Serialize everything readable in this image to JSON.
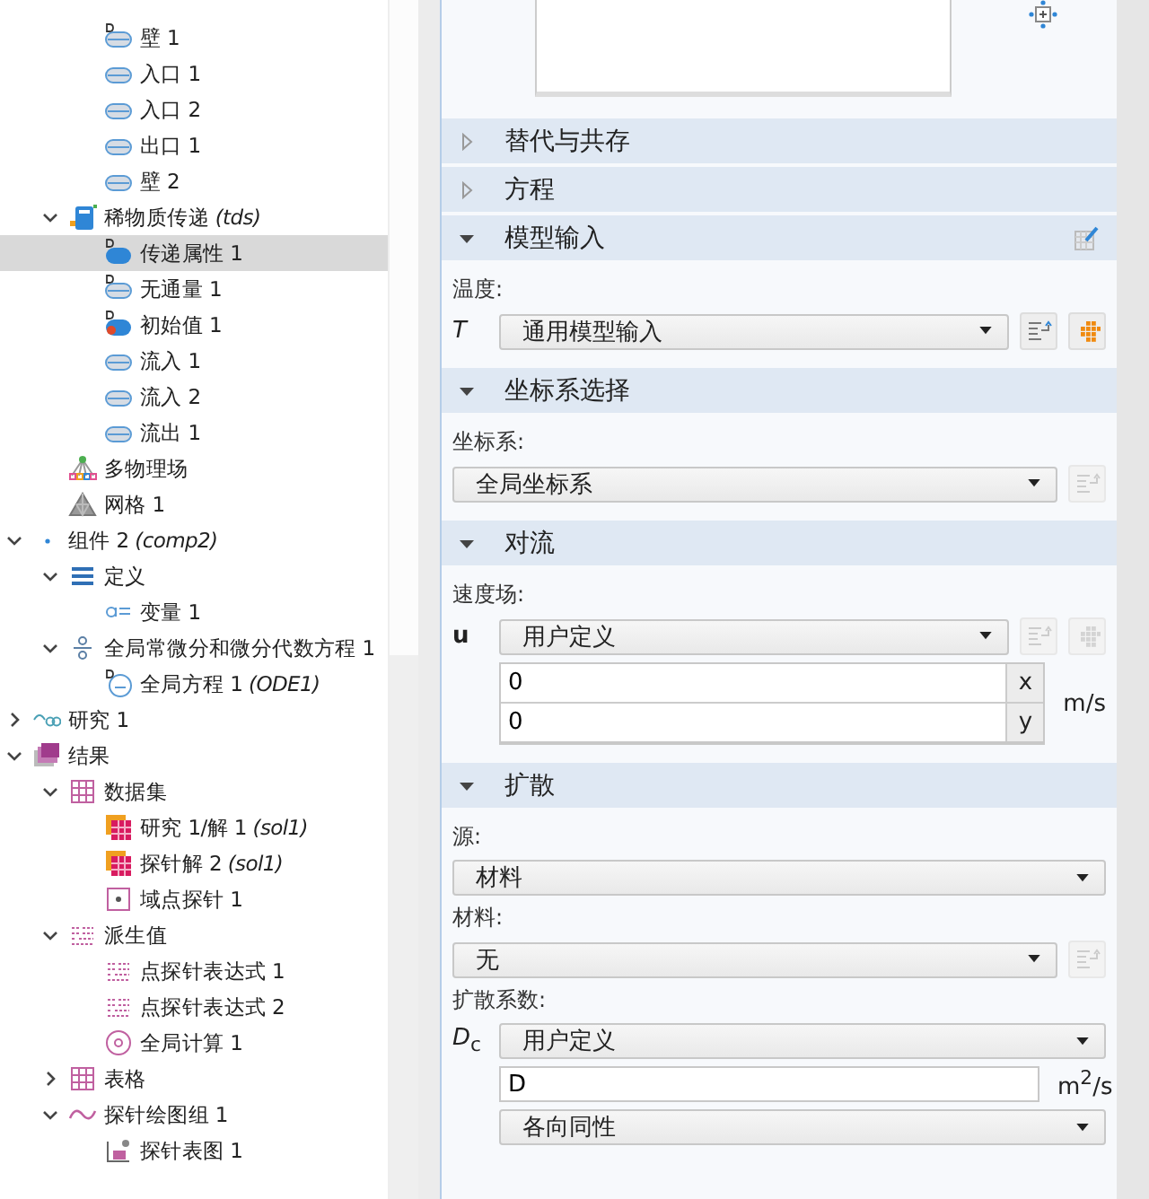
{
  "tree": [
    {
      "children": [
        {
          "children": [
            {
              "label": "壁 1",
              "kind": "boundary-d",
              "selected": false
            },
            {
              "label": "入口 1",
              "kind": "boundary",
              "selected": false
            },
            {
              "label": "入口 2",
              "kind": "boundary",
              "selected": false
            },
            {
              "label": "出口 1",
              "kind": "boundary",
              "selected": false
            },
            {
              "label": "壁 2",
              "kind": "boundary",
              "selected": false
            }
          ]
        },
        {
          "label": "稀物质传递 *(tds)*",
          "kind": "physics",
          "expanded": true,
          "selected": false,
          "children": [
            {
              "label": "传递属性 1",
              "kind": "domain-d",
              "selected": true
            },
            {
              "label": "无通量 1",
              "kind": "boundary-d",
              "selected": false
            },
            {
              "label": "初始值 1",
              "kind": "init",
              "selected": false
            },
            {
              "label": "流入 1",
              "kind": "boundary",
              "selected": false
            },
            {
              "label": "流入 2",
              "kind": "boundary",
              "selected": false
            },
            {
              "label": "流出 1",
              "kind": "boundary",
              "selected": false
            }
          ]
        },
        {
          "label": "多物理场",
          "kind": "multiphysics",
          "selected": false
        },
        {
          "label": "网格 1",
          "kind": "mesh",
          "selected": false
        }
      ]
    },
    {
      "label": "组件 2 *(comp2)*",
      "kind": "component",
      "expanded": true,
      "selected": false,
      "children": [
        {
          "label": "定义",
          "kind": "definitions",
          "expanded": true,
          "selected": false,
          "children": [
            {
              "label": "变量 1",
              "kind": "variable",
              "selected": false
            }
          ]
        },
        {
          "label": "全局常微分和微分代数方程 1",
          "kind": "ode",
          "expanded": true,
          "selected": false,
          "children": [
            {
              "label": "全局方程 1 *(ODE1)*",
              "kind": "ode-eq",
              "selected": false
            }
          ]
        }
      ]
    },
    {
      "label": "研究 1",
      "kind": "study",
      "expanded": false,
      "selected": false
    },
    {
      "label": "结果",
      "kind": "results",
      "expanded": true,
      "selected": false,
      "children": [
        {
          "label": "数据集",
          "kind": "datasets",
          "expanded": true,
          "selected": false,
          "children": [
            {
              "label": "研究 1/解 1 *(sol1)*",
              "kind": "solution",
              "selected": false
            },
            {
              "label": "探针解 2 *(sol1)*",
              "kind": "solution",
              "selected": false
            },
            {
              "label": "域点探针 1",
              "kind": "probe",
              "selected": false
            }
          ]
        },
        {
          "label": "派生值",
          "kind": "derived",
          "expanded": true,
          "selected": false,
          "children": [
            {
              "label": "点探针表达式 1",
              "kind": "derived",
              "selected": false
            },
            {
              "label": "点探针表达式 2",
              "kind": "derived",
              "selected": false
            },
            {
              "label": "全局计算 1",
              "kind": "global-eval",
              "selected": false
            }
          ]
        },
        {
          "label": "表格",
          "kind": "table",
          "expanded": false,
          "selected": false
        },
        {
          "label": "探针绘图组 1",
          "kind": "plotgroup",
          "expanded": true,
          "selected": false,
          "children": [
            {
              "label": "探针表图 1",
              "kind": "plot",
              "selected": false
            }
          ]
        }
      ]
    }
  ],
  "sections": [
    {
      "title": "替代与共存",
      "expanded": false
    },
    {
      "title": "方程",
      "expanded": false
    },
    {
      "title": "模型输入",
      "expanded": true,
      "edit_button": true,
      "fields": [
        {
          "kind": "label",
          "text": "温度:"
        },
        {
          "kind": "select",
          "symbol": "*T*",
          "value": "通用模型输入",
          "buttons": [
            {
              "kind": "list",
              "disabled": false
            },
            {
              "kind": "dots",
              "disabled": false
            }
          ]
        }
      ]
    },
    {
      "title": "坐标系选择",
      "expanded": true,
      "fields": [
        {
          "kind": "label",
          "text": "坐标系:"
        },
        {
          "kind": "select",
          "value": "全局坐标系",
          "buttons": [
            {
              "kind": "list",
              "disabled": true
            }
          ]
        }
      ]
    },
    {
      "title": "对流",
      "expanded": true,
      "fields": [
        {
          "kind": "label",
          "text": "速度场:"
        },
        {
          "kind": "select",
          "symbol": "**u**",
          "value": "用户定义",
          "buttons": [
            {
              "kind": "list",
              "disabled": true
            },
            {
              "kind": "dots",
              "disabled": true
            }
          ]
        },
        {
          "kind": "vector",
          "unit": "m/s",
          "components": [
            {
              "value": "0",
              "axis": "x"
            },
            {
              "value": "0",
              "axis": "y"
            }
          ]
        }
      ]
    },
    {
      "title": "扩散",
      "expanded": true,
      "fields": [
        {
          "kind": "label",
          "text": "源:"
        },
        {
          "kind": "select",
          "value": "材料"
        },
        {
          "kind": "label",
          "text": "材料:"
        },
        {
          "kind": "select",
          "value": "无",
          "buttons": [
            {
              "kind": "list",
              "disabled": true
            }
          ]
        },
        {
          "kind": "label",
          "text": "扩散系数:"
        },
        {
          "kind": "select",
          "symbol": "*D*$_{c}$",
          "value": "用户定义"
        },
        {
          "kind": "input",
          "value": "D",
          "unit": "m$^{2}$/s"
        },
        {
          "kind": "indented-select",
          "value": "各向同性"
        }
      ]
    }
  ]
}
